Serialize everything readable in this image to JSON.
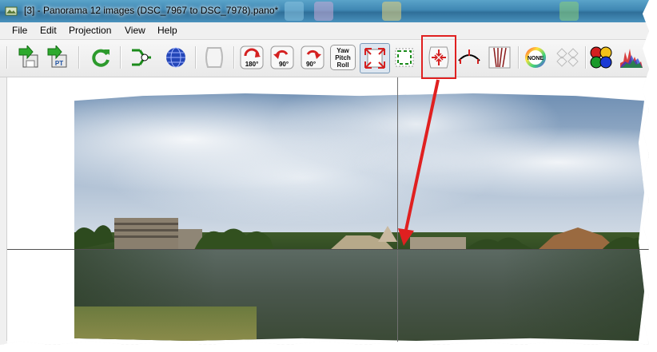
{
  "window": {
    "title": "[3] - Panorama 12 images (DSC_7967 to DSC_7978).pano*"
  },
  "menu": [
    "File",
    "Edit",
    "Projection",
    "View",
    "Help"
  ],
  "toolbar": {
    "buttons": [
      {
        "name": "save-icon"
      },
      {
        "name": "export-pt-icon",
        "label": "PT"
      },
      {
        "name": "refresh-icon"
      },
      {
        "name": "control-points-icon"
      },
      {
        "name": "sphere-preview-icon"
      },
      {
        "name": "frame-disabled-icon"
      },
      {
        "name": "rotate-180-icon",
        "label": "180°"
      },
      {
        "name": "rotate-ccw-90-icon",
        "label": "90°"
      },
      {
        "name": "rotate-cw-90-icon",
        "label": "90°"
      },
      {
        "name": "yaw-pitch-roll-button",
        "label_lines": [
          "Yaw",
          "Pitch",
          "Roll"
        ]
      },
      {
        "name": "fit-panorama-icon"
      },
      {
        "name": "crop-icon"
      },
      {
        "name": "center-panorama-icon"
      },
      {
        "name": "straighten-icon"
      },
      {
        "name": "vertical-lines-icon"
      },
      {
        "name": "color-none-icon",
        "label": "NONE"
      },
      {
        "name": "blend-disabled-icon"
      },
      {
        "name": "color-channels-icon"
      },
      {
        "name": "histogram-icon"
      }
    ]
  },
  "colors": {
    "highlight": "#e02020",
    "arrow": "#e02020",
    "title_bar": "#3f87b3"
  }
}
